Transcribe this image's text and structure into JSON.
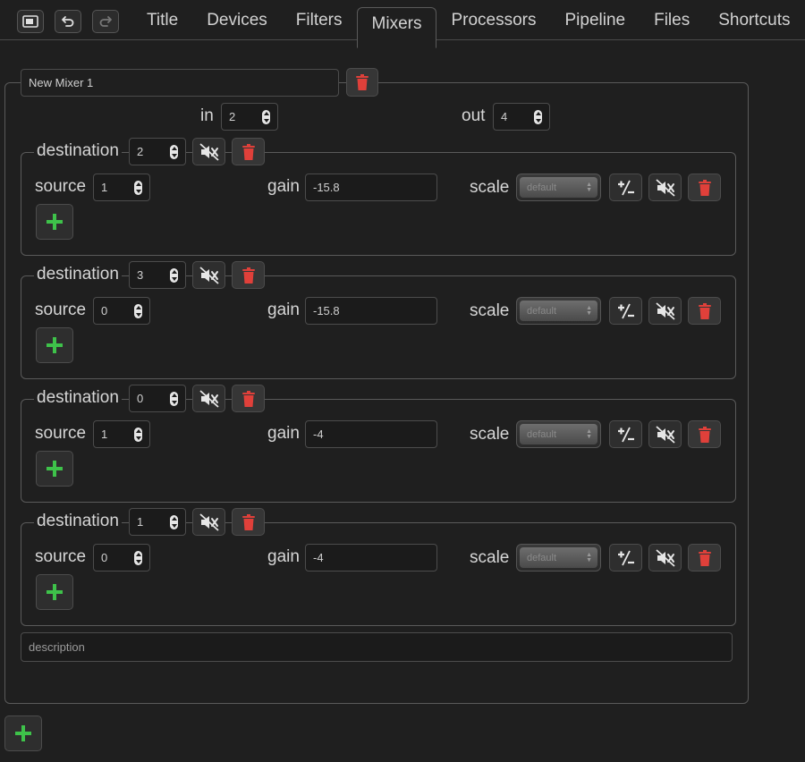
{
  "toolbar": {
    "icons": [
      "screen-icon",
      "undo-icon",
      "redo-icon"
    ]
  },
  "tabs": [
    {
      "label": "Title",
      "active": false
    },
    {
      "label": "Devices",
      "active": false
    },
    {
      "label": "Filters",
      "active": false
    },
    {
      "label": "Mixers",
      "active": true
    },
    {
      "label": "Processors",
      "active": false
    },
    {
      "label": "Pipeline",
      "active": false
    },
    {
      "label": "Files",
      "active": false
    },
    {
      "label": "Shortcuts",
      "active": false
    }
  ],
  "mixer": {
    "name": "New Mixer 1",
    "in_label": "in",
    "in_value": "2",
    "out_label": "out",
    "out_value": "4",
    "description_placeholder": "description",
    "destinations": [
      {
        "label": "destination",
        "value": "2",
        "source_label": "source",
        "source": "1",
        "gain_label": "gain",
        "gain": "-15.8",
        "scale_label": "scale",
        "scale": "default"
      },
      {
        "label": "destination",
        "value": "3",
        "source_label": "source",
        "source": "0",
        "gain_label": "gain",
        "gain": "-15.8",
        "scale_label": "scale",
        "scale": "default"
      },
      {
        "label": "destination",
        "value": "0",
        "source_label": "source",
        "source": "1",
        "gain_label": "gain",
        "gain": "-4",
        "scale_label": "scale",
        "scale": "default"
      },
      {
        "label": "destination",
        "value": "1",
        "source_label": "source",
        "source": "0",
        "gain_label": "gain",
        "gain": "-4",
        "scale_label": "scale",
        "scale": "default"
      }
    ]
  },
  "colors": {
    "background": "#1f1f1f",
    "delete": "#e0403a",
    "add": "#3ec24a"
  }
}
